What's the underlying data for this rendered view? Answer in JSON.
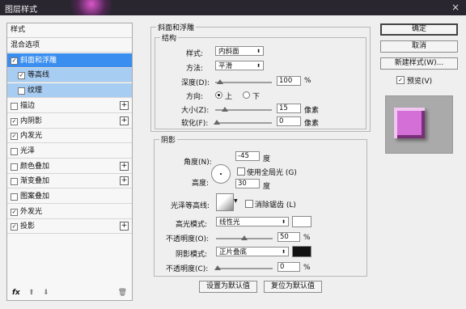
{
  "window": {
    "title": "图层样式",
    "close": "×"
  },
  "left": {
    "header": "样式",
    "items": [
      {
        "label": "混合选项",
        "checkbox": false,
        "plus": false
      },
      {
        "label": "斜面和浮雕",
        "checkbox": true,
        "checked": true,
        "plus": false,
        "state": "selected"
      },
      {
        "label": "等高线",
        "checkbox": true,
        "checked": true,
        "plus": false,
        "state": "sub"
      },
      {
        "label": "纹理",
        "checkbox": true,
        "checked": false,
        "plus": false,
        "state": "sub"
      },
      {
        "label": "描边",
        "checkbox": true,
        "checked": false,
        "plus": true
      },
      {
        "label": "内阴影",
        "checkbox": true,
        "checked": true,
        "plus": true
      },
      {
        "label": "内发光",
        "checkbox": true,
        "checked": true,
        "plus": false
      },
      {
        "label": "光泽",
        "checkbox": true,
        "checked": false,
        "plus": false
      },
      {
        "label": "颜色叠加",
        "checkbox": true,
        "checked": false,
        "plus": true
      },
      {
        "label": "渐变叠加",
        "checkbox": true,
        "checked": false,
        "plus": true
      },
      {
        "label": "图案叠加",
        "checkbox": true,
        "checked": false,
        "plus": false
      },
      {
        "label": "外发光",
        "checkbox": true,
        "checked": true,
        "plus": false
      },
      {
        "label": "投影",
        "checkbox": true,
        "checked": true,
        "plus": true
      }
    ],
    "footer": {
      "fx": "fx",
      "up": "⬆",
      "down": "⬇",
      "trash": "🗑"
    }
  },
  "bevel": {
    "title": "斜面和浮雕",
    "structure": {
      "title": "结构",
      "style_label": "样式:",
      "style_value": "内斜面",
      "technique_label": "方法:",
      "technique_value": "平滑",
      "depth_label": "深度(D):",
      "depth_value": "100",
      "depth_unit": "%",
      "direction_label": "方向:",
      "up_label": "上",
      "down_label": "下",
      "direction_selected": "上",
      "size_label": "大小(Z):",
      "size_value": "15",
      "size_unit": "像素",
      "soften_label": "软化(F):",
      "soften_value": "0",
      "soften_unit": "像素"
    },
    "shading": {
      "title": "阴影",
      "angle_label": "角度(N):",
      "angle_value": "-45",
      "angle_unit": "度",
      "global_light_label": "使用全局光 (G)",
      "global_light_checked": false,
      "altitude_label": "高度:",
      "altitude_value": "30",
      "altitude_unit": "度",
      "gloss_label": "光泽等高线:",
      "antialias_label": "消除锯齿 (L)",
      "antialias_checked": false,
      "highlight_mode_label": "高光模式:",
      "highlight_mode_value": "线性光",
      "highlight_color": "#ffffff",
      "highlight_opacity_label": "不透明度(O):",
      "highlight_opacity_value": "50",
      "highlight_opacity_unit": "%",
      "shadow_mode_label": "阴影模式:",
      "shadow_mode_value": "正片叠底",
      "shadow_color": "#111111",
      "shadow_opacity_label": "不透明度(C):",
      "shadow_opacity_value": "0",
      "shadow_opacity_unit": "%"
    },
    "set_default": "设置为默认值",
    "reset_default": "复位为默认值"
  },
  "right": {
    "ok": "确定",
    "cancel": "取消",
    "new_style": "新建样式(W)...",
    "preview_label": "预览(V)",
    "preview_checked": true,
    "preview_color": "#d36fd6"
  }
}
